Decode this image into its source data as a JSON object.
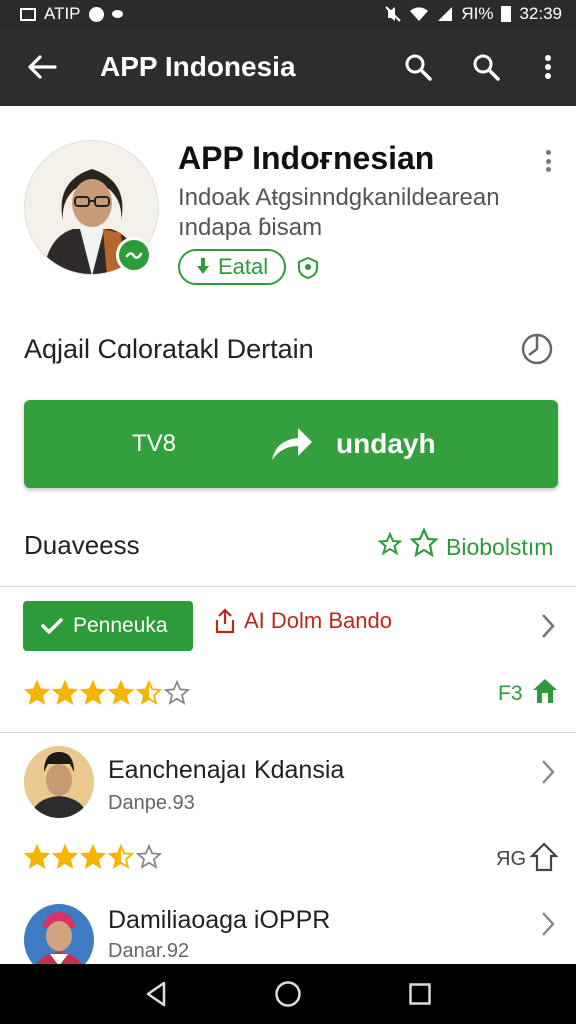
{
  "status_bar": {
    "carrier": "ATIP",
    "battery": "ЯI%",
    "time": "32:39"
  },
  "app_bar": {
    "title": "APP Indonesia",
    "icons": [
      "back-arrow-icon",
      "search-icon",
      "search-icon",
      "more-vert-icon"
    ]
  },
  "app_header": {
    "name": "APP Indoғnesian",
    "developer": "Indoak Aŧgsinndgkanildearean",
    "subtitle": "ındapa ɓisam",
    "chip_label": "Eatal"
  },
  "section": {
    "title": "Aqjail Cɑloratakl Dertain"
  },
  "install_button": {
    "tag": "TV8",
    "label": "undayh"
  },
  "reviews_header": {
    "title": "Duaveess",
    "action_label": "Biobolstım"
  },
  "actions_row": {
    "green_button_label": "Penneuka",
    "link_label": "AI Dolm Bando"
  },
  "rating_summary": {
    "stars_filled": 4.5,
    "stars_total": 6,
    "count": "F3"
  },
  "reviews": [
    {
      "name": "Eanchenajaı Kdansia",
      "date": "Danpe.93",
      "stars_filled": 3.5,
      "stars_total": 5,
      "count": "ЯG"
    },
    {
      "name": "Damiliaoaga iOPPR",
      "date": "Danar.92"
    }
  ],
  "colors": {
    "accent_green": "#34a03d",
    "app_bar": "#2d2d2d",
    "link_red": "#b52a1c",
    "star_yellow": "#f4b400"
  }
}
